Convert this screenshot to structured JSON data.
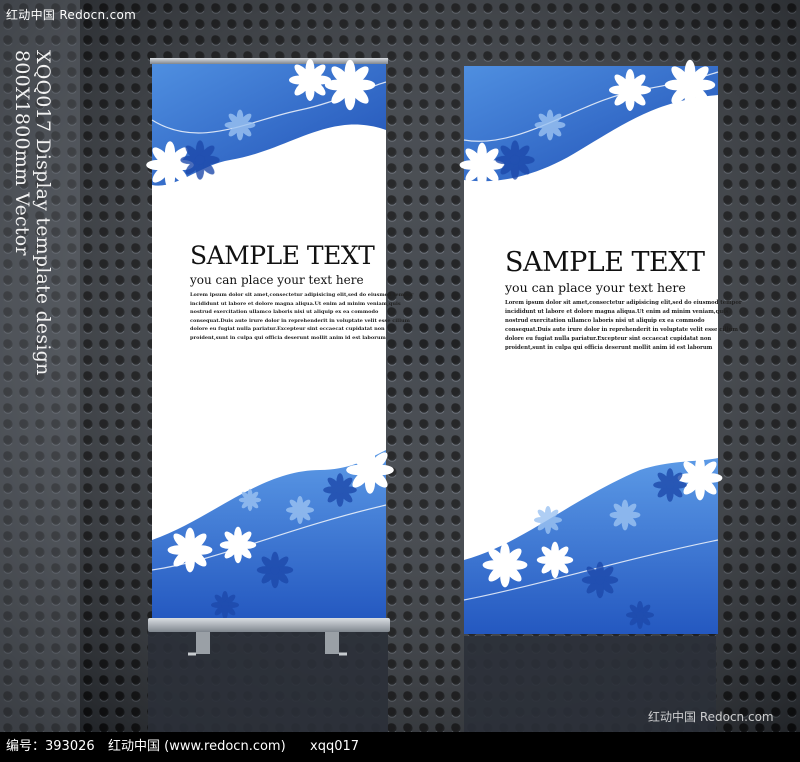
{
  "watermarks": {
    "top": "红动中国 Redocn.com",
    "bottom": "红动中国 Redocn.com"
  },
  "vertical_title": {
    "line1": "XQQ017 Display template design",
    "line2": "800X1800mm Vector"
  },
  "banners": [
    {
      "heading": "SAMPLE TEXT",
      "subheading": "you can place your text here",
      "body": [
        "Lorem ipsum dolor sit amet,consectetur adipisicing elit,sed do eiusmod tempor",
        "incididunt ut labore et dolore magna aliqua.Ut enim ad minim veniam,quis",
        "nostrud exercitation ullamco laboris nisi ut aliquip ex ea commodo",
        "consequat.Duis aute irure dolor in reprehenderit in voluptate velit esse cillum",
        "dolore eu fugiat nulla pariatur.Excepteur sint occaecat cupidatat non",
        "proident,sunt in culpa qui officia deserunt mollit anim id est laborum"
      ]
    },
    {
      "heading": "SAMPLE TEXT",
      "subheading": "you can place your text here",
      "body": [
        "Lorem ipsum dolor sit amet,consectetur adipisicing elit,sed do eiusmod tempor",
        "incididunt ut labore et dolore magna aliqua.Ut enim ad minim veniam,quis",
        "nostrud exercitation ullamco laboris nisi ut aliquip ex ea commodo",
        "consequat.Duis aute irure dolor in reprehenderit in voluptate velit esse cillum",
        "dolore eu fugiat nulla pariatur.Excepteur sint occaecat cupidatat non",
        "proident,sunt in culpa qui officia deserunt mollit anim id est laborum"
      ]
    }
  ],
  "footer": {
    "id_label": "编号：393026",
    "site": "红动中国 (www.redocn.com)",
    "code": "xqq017"
  },
  "colors": {
    "background": "#1b1f24",
    "banner_blue": "#2f64c4",
    "banner_light_blue": "#7fb0ec",
    "stand_gray": "#9aa0a6"
  }
}
